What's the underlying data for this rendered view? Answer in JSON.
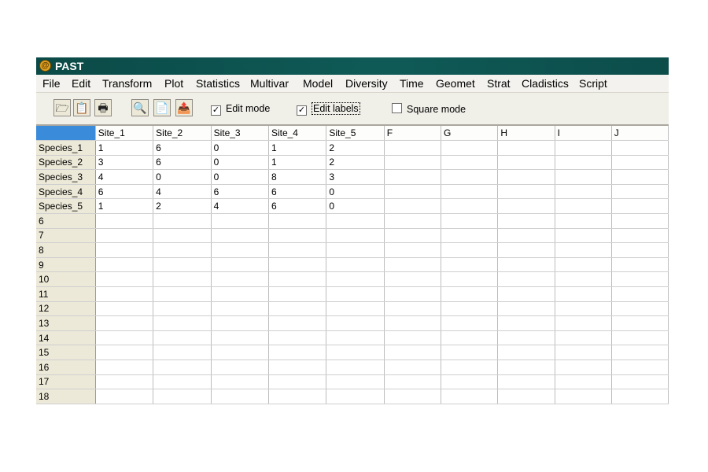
{
  "window": {
    "title": "PAST"
  },
  "menu": [
    "File",
    "Edit",
    "Transform",
    "Plot",
    "Statistics",
    "Multivar",
    "Model",
    "Diversity",
    "Time",
    "Geomet",
    "Strat",
    "Cladistics",
    "Script"
  ],
  "toolbar": {
    "buttons": [
      {
        "name": "open-button",
        "icon": "folder-open-icon",
        "glyph": "🗁"
      },
      {
        "name": "paste-button",
        "icon": "paste-icon",
        "glyph": "📋"
      },
      {
        "name": "print-button",
        "icon": "printer-icon",
        "glyph": "🖶"
      },
      {
        "name": "find-button",
        "icon": "binoculars-icon",
        "glyph": "🔍"
      },
      {
        "name": "copy-button",
        "icon": "copy-icon",
        "glyph": "📄"
      },
      {
        "name": "export-button",
        "icon": "export-icon",
        "glyph": "📤"
      }
    ],
    "checkboxes": [
      {
        "name": "edit-mode",
        "label": "Edit mode",
        "checked": true
      },
      {
        "name": "edit-labels",
        "label": "Edit labels",
        "checked": true,
        "focused": true
      },
      {
        "name": "square-mode",
        "label": "Square mode",
        "checked": false
      }
    ]
  },
  "grid": {
    "columns": [
      "Site_1",
      "Site_2",
      "Site_3",
      "Site_4",
      "Site_5",
      "F",
      "G",
      "H",
      "I",
      "J"
    ],
    "rows": [
      {
        "label": "Species_1",
        "cells": [
          "1",
          "6",
          "0",
          "1",
          "2"
        ]
      },
      {
        "label": "Species_2",
        "cells": [
          "3",
          "6",
          "0",
          "1",
          "2"
        ]
      },
      {
        "label": "Species_3",
        "cells": [
          "4",
          "0",
          "0",
          "8",
          "3"
        ]
      },
      {
        "label": "Species_4",
        "cells": [
          "6",
          "4",
          "6",
          "6",
          "0"
        ]
      },
      {
        "label": "Species_5",
        "cells": [
          "1",
          "2",
          "4",
          "6",
          "0"
        ]
      },
      {
        "label": "6",
        "cells": []
      },
      {
        "label": "7",
        "cells": []
      },
      {
        "label": "8",
        "cells": []
      },
      {
        "label": "9",
        "cells": []
      },
      {
        "label": "10",
        "cells": []
      },
      {
        "label": "11",
        "cells": []
      },
      {
        "label": "12",
        "cells": []
      },
      {
        "label": "13",
        "cells": []
      },
      {
        "label": "14",
        "cells": []
      },
      {
        "label": "15",
        "cells": []
      },
      {
        "label": "16",
        "cells": []
      },
      {
        "label": "17",
        "cells": []
      },
      {
        "label": "18",
        "cells": []
      }
    ]
  },
  "colors": {
    "titlebar": "#0f5a57",
    "corner_cell": "#3b8bdb",
    "row_header": "#ece9d8"
  }
}
